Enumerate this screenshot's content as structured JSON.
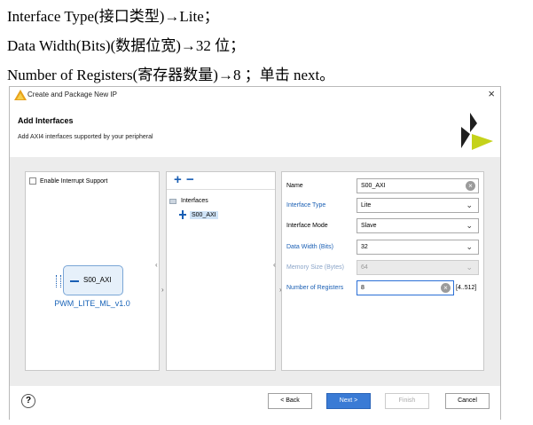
{
  "doc": {
    "line1": "Interface Type(接口类型)→Lite；",
    "line2": "Data Width(Bits)(数据位宽)→32 位；",
    "line3": "Number of    Registers(寄存器数量)→8  ；单击 next。"
  },
  "window": {
    "title": "Create and Package New IP",
    "close_label": "×"
  },
  "header": {
    "title": "Add Interfaces",
    "subtitle": "Add AXI4 interfaces supported by your peripheral"
  },
  "left_panel": {
    "interrupt_label": "Enable Interrupt Support",
    "block_label": "S00_AXI",
    "ip_name": "PWM_LITE_ML_v1.0"
  },
  "mid_panel": {
    "plus": "+",
    "minus": "−",
    "folder_label": "Interfaces",
    "item_label": "S00_AXI"
  },
  "form": {
    "name_label": "Name",
    "name_value": "S00_AXI",
    "type_label": "Interface Type",
    "type_value": "Lite",
    "mode_label": "Interface Mode",
    "mode_value": "Slave",
    "width_label": "Data Width (Bits)",
    "width_value": "32",
    "memsize_label": "Memory Size (Bytes)",
    "memsize_value": "64",
    "regs_label": "Number of Registers",
    "regs_value": "8",
    "regs_range": "[4..512]"
  },
  "footer": {
    "help": "?",
    "back": "< Back",
    "next": "Next >",
    "finish": "Finish",
    "cancel": "Cancel"
  },
  "colors": {
    "accent": "#1a5fb4",
    "next_button": "#3a7bd5",
    "brand_yellow": "#c5d21b"
  }
}
